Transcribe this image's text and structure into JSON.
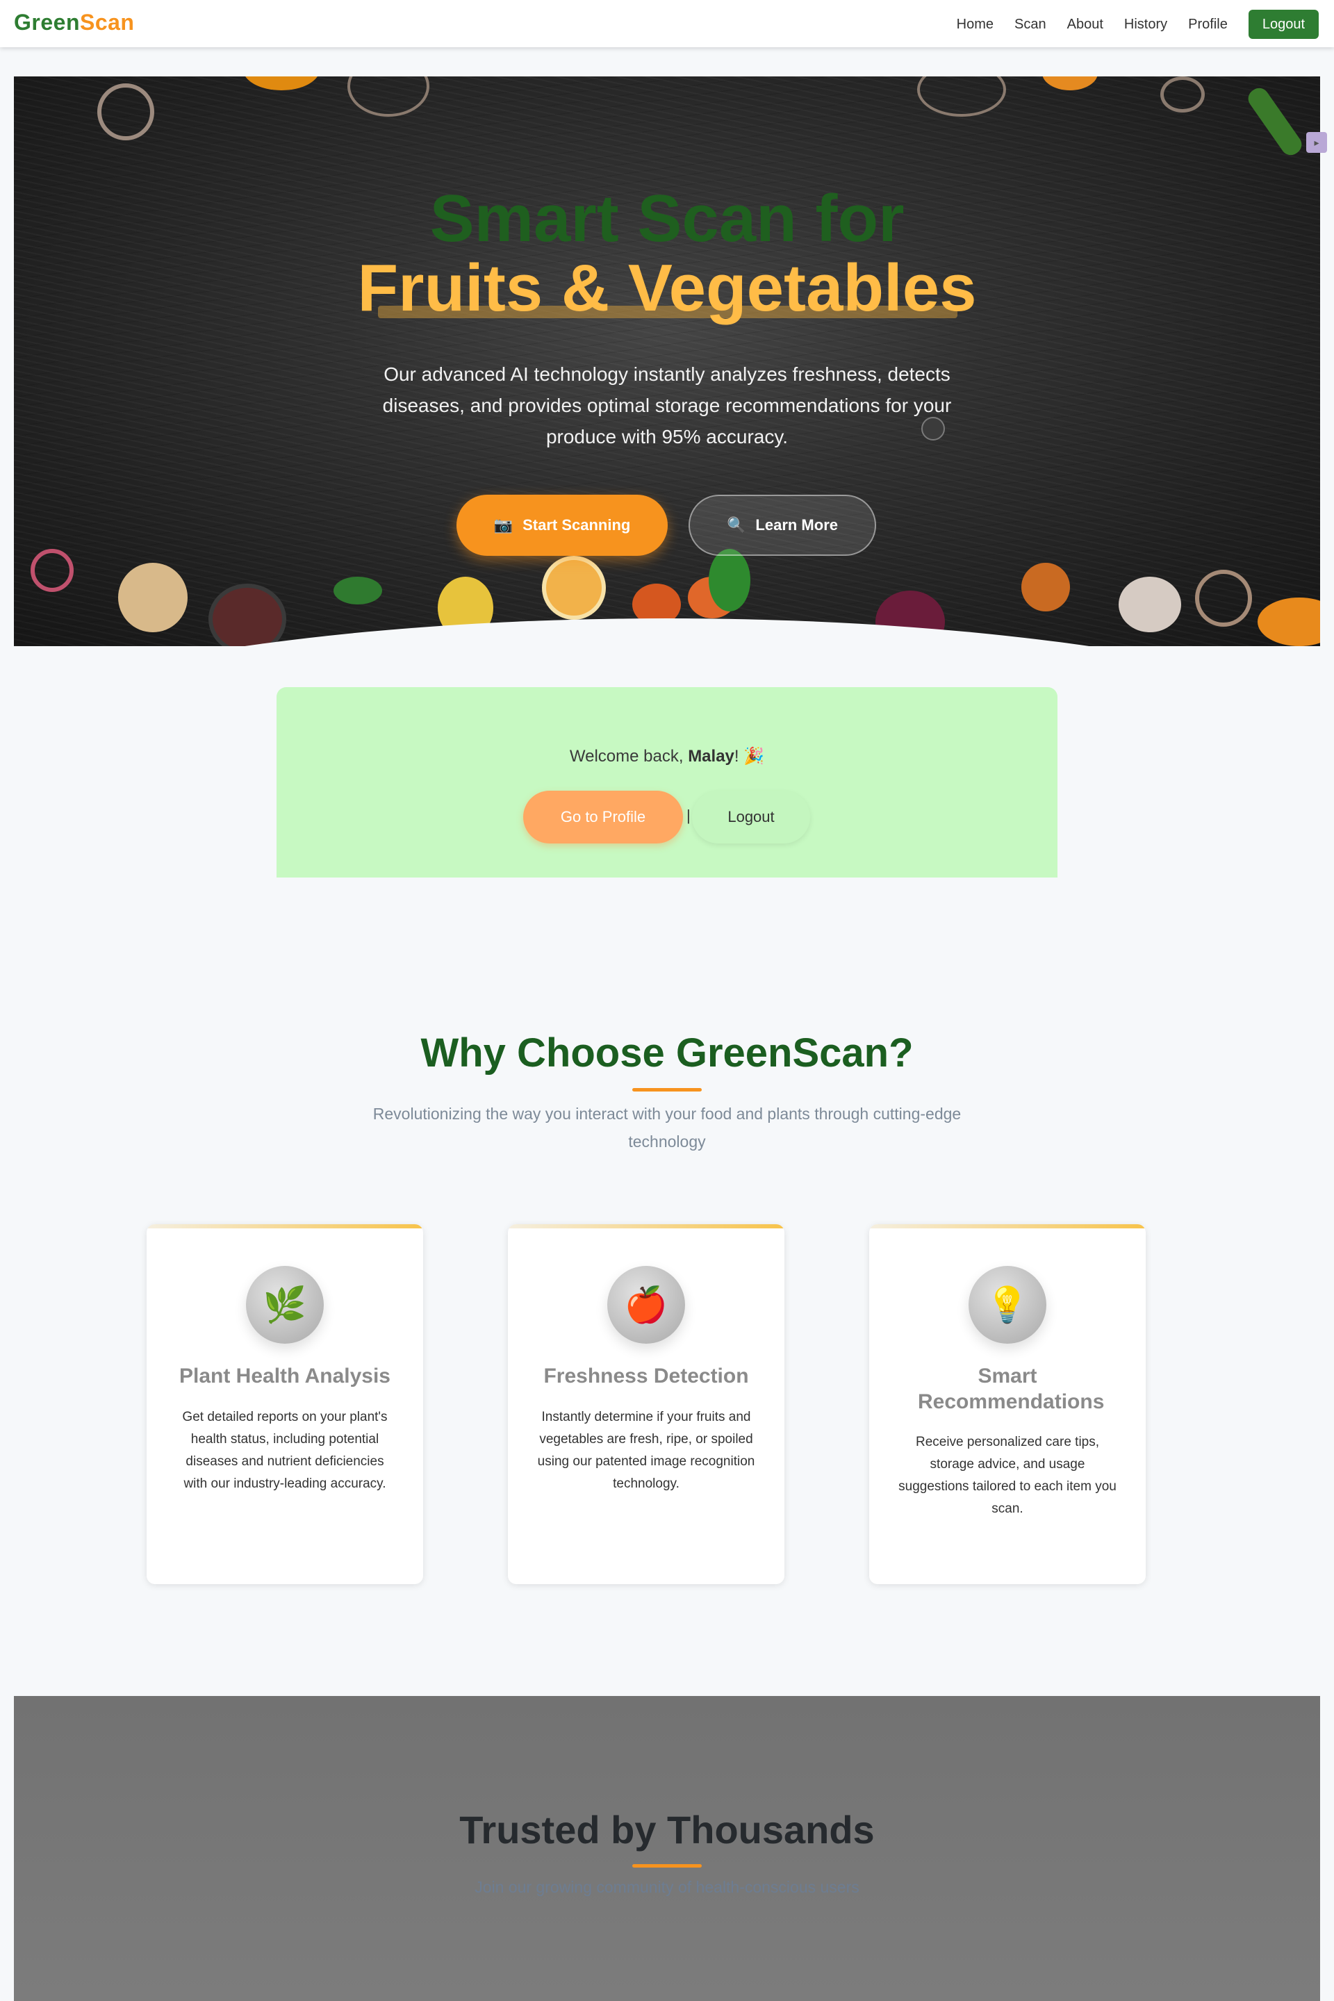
{
  "nav": {
    "brand_green": "Green",
    "brand_orange": "Scan",
    "links": [
      "Home",
      "Scan",
      "About",
      "History",
      "Profile"
    ],
    "logout": "Logout"
  },
  "hero": {
    "title_line1": "Smart Scan for",
    "title_line2": "Fruits & Vegetables",
    "description": "Our advanced AI technology instantly analyzes freshness, detects diseases, and provides optimal storage recommendations for your produce with 95% accuracy.",
    "start_icon": "📷",
    "start_label": "Start Scanning",
    "learn_icon": "🔍",
    "learn_label": "Learn More"
  },
  "welcome": {
    "prefix": "Welcome back, ",
    "name": "Malay",
    "suffix": "! 🎉",
    "profile_button": "Go to Profile",
    "separator": "|",
    "logout_button": "Logout"
  },
  "why": {
    "title": "Why Choose GreenScan?",
    "subtitle": "Revolutionizing the way you interact with your food and plants through cutting-edge technology",
    "cards": [
      {
        "icon": "🌿",
        "title": "Plant Health Analysis",
        "description": "Get detailed reports on your plant's health status, including potential diseases and nutrient deficiencies with our industry-leading accuracy."
      },
      {
        "icon": "🍎",
        "title": "Freshness Detection",
        "description": "Instantly determine if your fruits and vegetables are fresh, ripe, or spoiled using our patented image recognition technology."
      },
      {
        "icon": "💡",
        "title": "Smart Recommendations",
        "description": "Receive personalized care tips, storage advice, and usage suggestions tailored to each item you scan."
      }
    ]
  },
  "trusted": {
    "title": "Trusted by Thousands",
    "subtitle": "Join our growing community of health-conscious users"
  },
  "colors": {
    "brand_green": "#2e7d32",
    "brand_orange": "#f7931e",
    "hero_gold": "#ffbc47",
    "welcome_bg": "#c7f9c2"
  }
}
